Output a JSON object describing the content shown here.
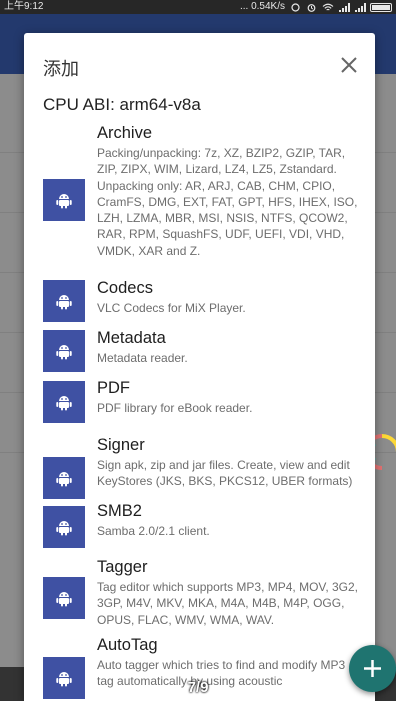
{
  "status_bar": {
    "time": "上午9:12",
    "network_speed": "... 0.54K/s"
  },
  "dialog": {
    "title": "添加",
    "cpu_abi_label": "CPU ABI: arm64-v8a",
    "items": [
      {
        "name": "Archive",
        "desc": "Packing/unpacking: 7z, XZ, BZIP2, GZIP, TAR, ZIP, ZIPX, WIM, Lizard, LZ4, LZ5, Zstandard.\nUnpacking only: AR, ARJ, CAB, CHM, CPIO, CramFS, DMG, EXT, FAT, GPT, HFS, IHEX, ISO, LZH, LZMA, MBR, MSI, NSIS, NTFS, QCOW2, RAR, RPM, SquashFS, UDF, UEFI, VDI, VHD, VMDK, XAR and Z."
      },
      {
        "name": "Codecs",
        "desc": "VLC Codecs for MiX Player."
      },
      {
        "name": "Metadata",
        "desc": "Metadata reader."
      },
      {
        "name": "PDF",
        "desc": "PDF library for eBook reader."
      },
      {
        "name": "Signer",
        "desc": "Sign apk, zip and jar files. Create, view and edit KeyStores (JKS, BKS, PKCS12, UBER formats)"
      },
      {
        "name": "SMB2",
        "desc": "Samba 2.0/2.1 client."
      },
      {
        "name": "Tagger",
        "desc": "Tag editor which supports MP3, MP4, MOV, 3G2, 3GP, M4V, MKV, MKA, M4A, M4B, M4P, OGG, OPUS, FLAC, WMV, WMA, WAV."
      },
      {
        "name": "AutoTag",
        "desc": "Auto tagger which tries to find and modify MP3 tag automatically by using acoustic"
      }
    ]
  },
  "pager": {
    "indicator": "7/9"
  },
  "colors": {
    "plugin_icon_bg": "#3f51a3",
    "fab_bg": "#1f7470"
  },
  "icons": {
    "plugin": "android-icon",
    "close": "close-icon",
    "fab": "plus-icon"
  }
}
